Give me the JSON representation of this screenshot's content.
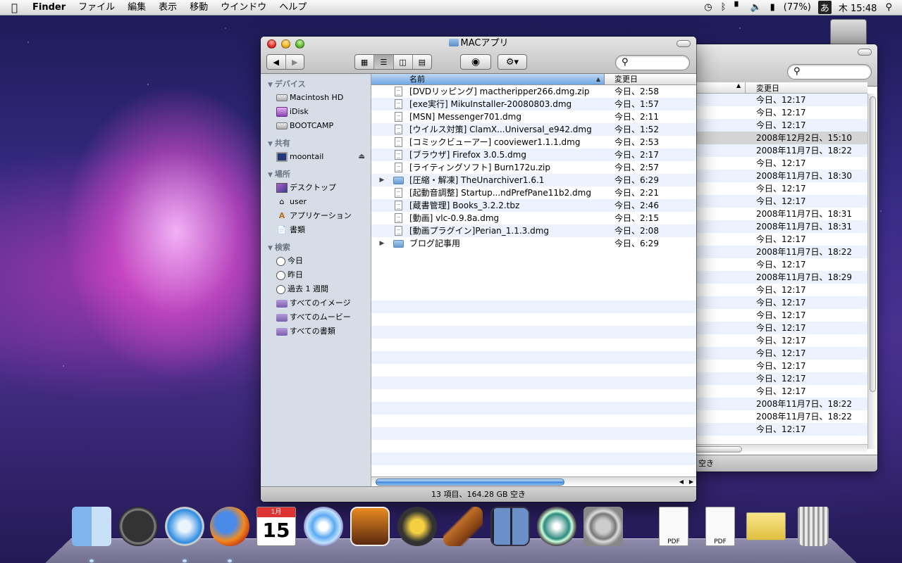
{
  "menubar": {
    "app_name": "Finder",
    "items": [
      "ファイル",
      "編集",
      "表示",
      "移動",
      "ウインドウ",
      "ヘルプ"
    ],
    "battery": "(77%)",
    "input_method": "あ",
    "clock": "木 15:48"
  },
  "front_window": {
    "title": "MACアプリ",
    "search_placeholder": "",
    "sidebar": {
      "devices_header": "デバイス",
      "devices": [
        "Macintosh HD",
        "iDisk",
        "BOOTCAMP"
      ],
      "shared_header": "共有",
      "shared": [
        "moontail"
      ],
      "places_header": "場所",
      "places": [
        "デスクトップ",
        "user",
        "アプリケーション",
        "書類"
      ],
      "search_header": "検索",
      "searches": [
        "今日",
        "昨日",
        "過去 1 週間",
        "すべてのイメージ",
        "すべてのムービー",
        "すべての書類"
      ]
    },
    "columns": {
      "name": "名前",
      "date": "変更日"
    },
    "files": [
      {
        "name": "[DVDリッピング] mactheripper266.dmg.zip",
        "date": "今日、2:58",
        "kind": "file"
      },
      {
        "name": "[exe実行] MikuInstaller-20080803.dmg",
        "date": "今日、1:57",
        "kind": "file"
      },
      {
        "name": "[MSN] Messenger701.dmg",
        "date": "今日、2:11",
        "kind": "file"
      },
      {
        "name": "[ウイルス対策] ClamX...Universal_e942.dmg",
        "date": "今日、1:52",
        "kind": "file"
      },
      {
        "name": "[コミックビューアー] cooviewer1.1.1.dmg",
        "date": "今日、2:53",
        "kind": "file"
      },
      {
        "name": "[ブラウザ] Firefox 3.0.5.dmg",
        "date": "今日、2:17",
        "kind": "file"
      },
      {
        "name": "[ライティングソフト] Burn172u.zip",
        "date": "今日、2:57",
        "kind": "file"
      },
      {
        "name": "[圧縮・解凍] TheUnarchiver1.6.1",
        "date": "今日、6:29",
        "kind": "folder"
      },
      {
        "name": "[起動音調整] Startup...ndPrefPane11b2.dmg",
        "date": "今日、2:21",
        "kind": "file"
      },
      {
        "name": "[蔵書管理] Books_3.2.2.tbz",
        "date": "今日、2:46",
        "kind": "file"
      },
      {
        "name": "[動画] vlc-0.9.8a.dmg",
        "date": "今日、2:15",
        "kind": "file"
      },
      {
        "name": "[動画プラグイン]Perian_1.1.3.dmg",
        "date": "今日、2:08",
        "kind": "file"
      },
      {
        "name": "ブログ記事用",
        "date": "今日、6:29",
        "kind": "folder"
      }
    ],
    "status": "13 項目、164.28 GB 空き"
  },
  "back_window": {
    "column_date": "変更日",
    "dates": [
      "今日、12:17",
      "今日、12:17",
      "今日、12:17",
      "2008年12月2日、15:10",
      "2008年11月7日、18:22",
      "今日、12:17",
      "2008年11月7日、18:30",
      "今日、12:17",
      "今日、12:17",
      "2008年11月7日、18:31",
      "2008年11月7日、18:31",
      "今日、12:17",
      "2008年11月7日、18:22",
      "今日、12:17",
      "2008年11月7日、18:29",
      "今日、12:17",
      "今日、12:17",
      "今日、12:17",
      "今日、12:17",
      "今日、12:17",
      "今日、12:17",
      "今日、12:17",
      "今日、12:17",
      "今日、12:17",
      "2008年11月7日、18:22",
      "2008年11月7日、18:22",
      "今日、12:17"
    ],
    "status": "空き"
  },
  "dock": {
    "calendar_month": "1月",
    "calendar_day": "15",
    "pdf_label": "PDF"
  }
}
